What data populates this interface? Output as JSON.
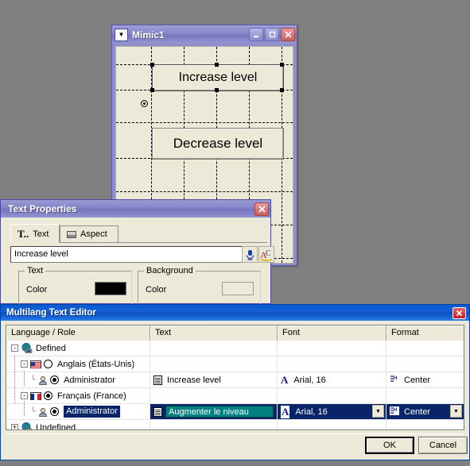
{
  "mimic": {
    "title": "Mimic1",
    "sysmenu_icon": "chevron-down-icon",
    "minimize_label": "_",
    "maximize_label": "□",
    "close_label": "✕",
    "buttons": [
      {
        "label": "Increase level",
        "selected": true
      },
      {
        "label": "Decrease level",
        "selected": false
      }
    ]
  },
  "text_properties": {
    "title": "Text Properties",
    "close_label": "✕",
    "tabs": [
      {
        "label": "Text",
        "icon": "text-T-icon",
        "active": true
      },
      {
        "label": "Aspect",
        "icon": "panel-icon",
        "active": false
      }
    ],
    "text_value": "Increase level",
    "text_placeholder": "",
    "button_multilang_icon": "multilang-icon",
    "button_font_icon": "AC-font-icon",
    "groups": {
      "text": {
        "legend": "Text",
        "color_label": "Color",
        "color_value": "#000000"
      },
      "background": {
        "legend": "Background",
        "color_label": "Color",
        "color_value": "#ece9d8"
      }
    }
  },
  "multilang": {
    "title": "Multilang Text Editor",
    "close_label": "✕",
    "columns": [
      "Language / Role",
      "Text",
      "Font",
      "Format"
    ],
    "rows": [
      {
        "indent": 0,
        "expander": "-",
        "icon": "globe-icon",
        "label": "Defined",
        "radio": null,
        "text": "",
        "font": "",
        "format": "",
        "selected": false
      },
      {
        "indent": 1,
        "expander": "-",
        "icon": "flag-us-icon",
        "label": "Anglais (États-Unis)",
        "radio": "off",
        "text": "",
        "font": "",
        "format": "",
        "selected": false
      },
      {
        "indent": 2,
        "expander": "",
        "icon": "role-icon",
        "label": "Administrator",
        "radio": "on",
        "text": "Increase level",
        "font": "Arial, 16",
        "format": "Center",
        "selected": false
      },
      {
        "indent": 1,
        "expander": "-",
        "icon": "flag-fr-icon",
        "label": "Français (France)",
        "radio": "on",
        "text": "",
        "font": "",
        "format": "",
        "selected": false
      },
      {
        "indent": 2,
        "expander": "",
        "icon": "role-icon",
        "label": "Administrator",
        "radio": "on",
        "text": "Augmenter le niveau",
        "font": "Arial, 16",
        "format": "Center",
        "selected": true
      },
      {
        "indent": 0,
        "expander": "+",
        "icon": "globe-icon",
        "label": "Undefined",
        "radio": null,
        "text": "",
        "font": "",
        "format": "",
        "selected": false
      }
    ],
    "ok_label": "OK",
    "cancel_label": "Cancel"
  },
  "colors": {
    "desktop": "#808080",
    "window_face": "#ece9d8",
    "selection_blue": "#0a246a",
    "edit_teal": "#008080",
    "title_blue": "#0a5ad0",
    "mimic_title": "#8686c9"
  }
}
